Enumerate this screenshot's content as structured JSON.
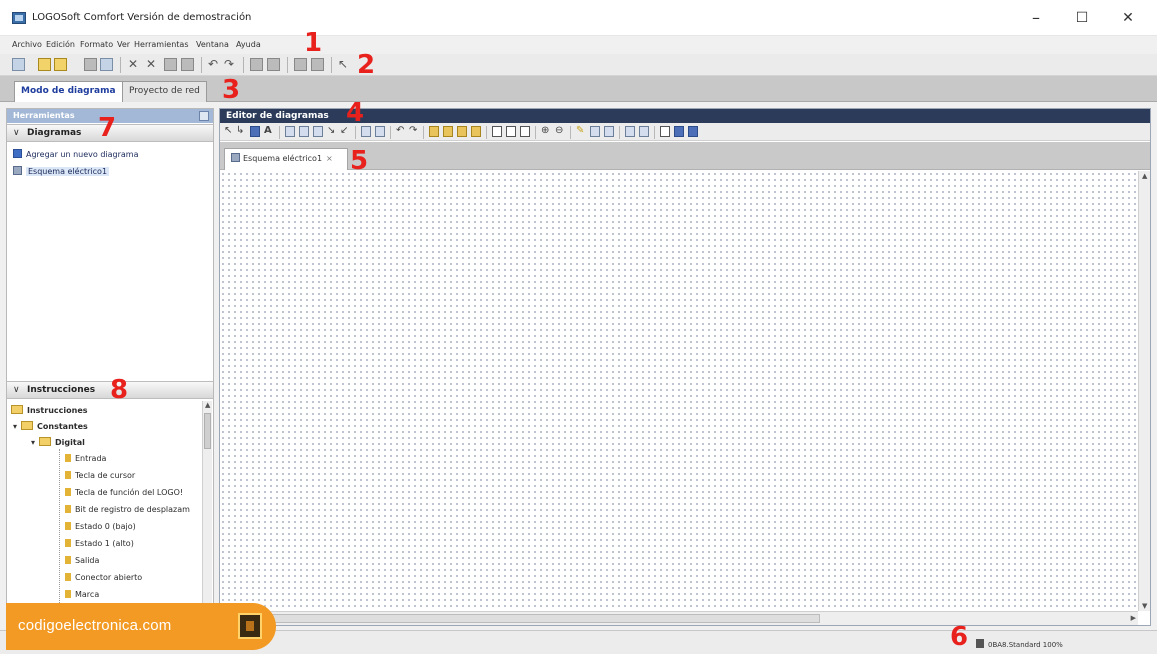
{
  "window": {
    "title": "LOGOSoft Comfort Versión de demostración",
    "controls": {
      "minimize": "–",
      "maximize": "☐",
      "close": "✕"
    }
  },
  "menu": {
    "items": [
      "Archivo",
      "Edición",
      "Formato",
      "Ver",
      "Herramientas",
      "Ventana",
      "Ayuda"
    ]
  },
  "mode_tabs": [
    {
      "label": "Modo de diagrama",
      "active": true
    },
    {
      "label": "Proyecto de red",
      "active": false
    }
  ],
  "annotations": [
    "1",
    "2",
    "3",
    "4",
    "5",
    "6",
    "7",
    "8"
  ],
  "left_panel": {
    "header": "Herramientas",
    "diagrams": {
      "title": "Diagramas",
      "items": [
        {
          "label": "Agregar un nuevo diagrama",
          "icon": "add-diagram-icon"
        },
        {
          "label": "Esquema eléctrico1",
          "icon": "diagram-icon",
          "selected": true
        }
      ]
    },
    "instructions": {
      "title": "Instrucciones",
      "root": "Instrucciones",
      "constants": "Constantes",
      "digital": "Digital",
      "items": [
        "Entrada",
        "Tecla de cursor",
        "Tecla de función del LOGO!",
        "Bit de registro de desplazam",
        "Estado 0 (bajo)",
        "Estado 1 (alto)",
        "Salida",
        "Conector abierto",
        "Marca"
      ]
    }
  },
  "editor": {
    "header": "Editor de diagramas",
    "tab": {
      "label": "Esquema eléctrico1",
      "close": "×"
    }
  },
  "status": {
    "text": "0BA8.Standard 100%"
  },
  "watermark": {
    "text": "codigoelectronica.com"
  },
  "colors": {
    "accent_red": "#e8211d",
    "editor_header": "#2b3b59",
    "brand_orange": "#f29a23"
  }
}
